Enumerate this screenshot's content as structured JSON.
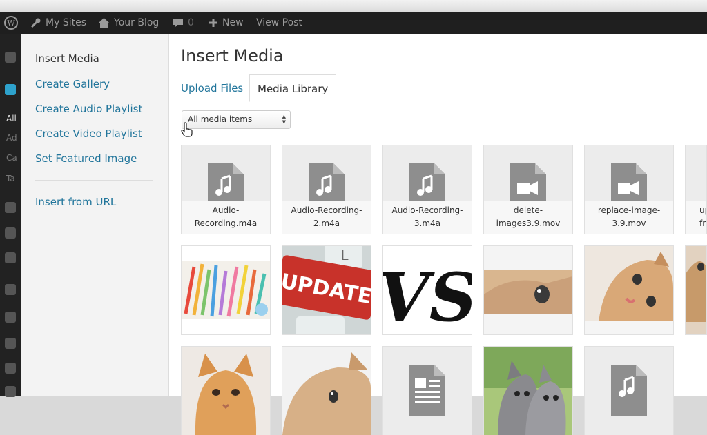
{
  "admin_bar": {
    "my_sites": "My Sites",
    "your_blog": "Your Blog",
    "comments_count": "0",
    "new": "New",
    "view_post": "View Post"
  },
  "left_rail": [
    "All",
    "Ad",
    "Ca",
    "Ta"
  ],
  "sidebar": {
    "items": [
      "Insert Media",
      "Create Gallery",
      "Create Audio Playlist",
      "Create Video Playlist",
      "Set Featured Image"
    ],
    "insert_from_url": "Insert from URL"
  },
  "main": {
    "title": "Insert Media",
    "tabs": [
      "Upload Files",
      "Media Library"
    ],
    "filter_selected": "All media items"
  },
  "media": {
    "row1": [
      {
        "type": "audio",
        "name_line1": "Audio-",
        "name_line2": "Recording.m4a"
      },
      {
        "type": "audio",
        "name_line1": "Audio-Recording-",
        "name_line2": "2.m4a"
      },
      {
        "type": "audio",
        "name_line1": "Audio-Recording-",
        "name_line2": "3.m4a"
      },
      {
        "type": "video",
        "name_line1": "delete-",
        "name_line2": "images3.9.mov"
      },
      {
        "type": "video",
        "name_line1": "replace-image-",
        "name_line2": "3.9.mov"
      },
      {
        "type": "partial",
        "name_line1": "up",
        "name_line2": "fro"
      }
    ],
    "row2": [
      "pencils-image",
      "update-key-image",
      "vs-image",
      "kitten-eye-image",
      "kitten-lying-image",
      "kitten-partial-image"
    ],
    "row2_update_text": "UPDATE",
    "row2_vs_text": "VS",
    "row3": [
      "persian-kitten-image",
      "kitten-peek-image",
      "document",
      "two-kittens-image",
      "audio-partial"
    ]
  }
}
